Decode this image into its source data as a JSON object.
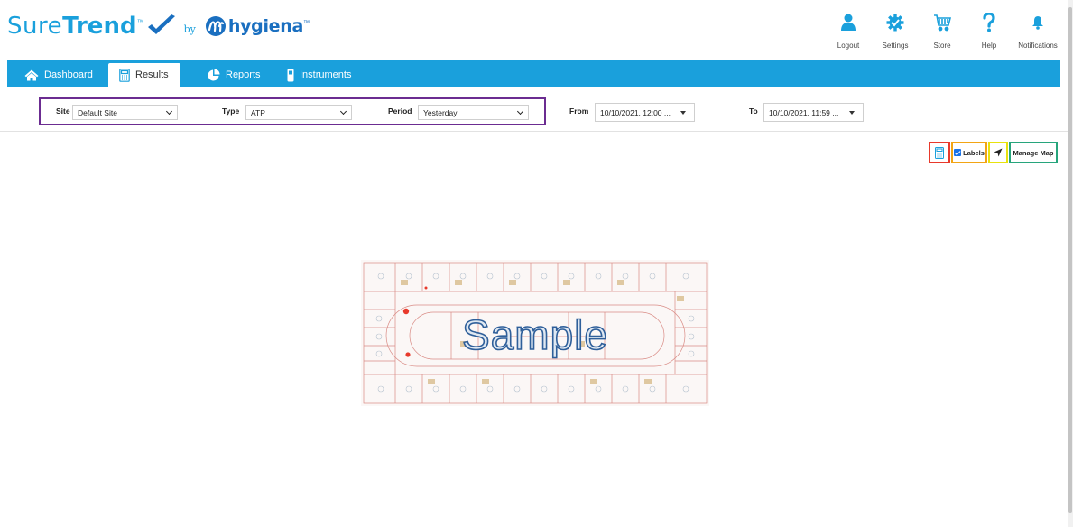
{
  "brand": {
    "name_part1": "Sure",
    "name_part2": "Trend",
    "tm": "™",
    "by": "by",
    "partner": "hygiena",
    "partner_tm": "™",
    "colors": {
      "primary": "#1aa0dc",
      "partner": "#1a6fc0"
    }
  },
  "top_nav": [
    {
      "label": "Logout",
      "icon": "user-icon"
    },
    {
      "label": "Settings",
      "icon": "gear-icon"
    },
    {
      "label": "Store",
      "icon": "cart-icon"
    },
    {
      "label": "Help",
      "icon": "question-icon"
    },
    {
      "label": "Notifications",
      "icon": "bell-icon"
    }
  ],
  "tabs": [
    {
      "label": "Dashboard",
      "icon": "home-icon",
      "active": false
    },
    {
      "label": "Results",
      "icon": "calculator-icon",
      "active": true
    },
    {
      "label": "Reports",
      "icon": "pie-chart-icon",
      "active": false
    },
    {
      "label": "Instruments",
      "icon": "device-icon",
      "active": false
    }
  ],
  "filters": {
    "site": {
      "label": "Site",
      "value": "Default Site"
    },
    "type": {
      "label": "Type",
      "value": "ATP"
    },
    "period": {
      "label": "Period",
      "value": "Yesterday"
    },
    "from": {
      "label": "From",
      "value": "10/10/2021, 12:00 ..."
    },
    "to": {
      "label": "To",
      "value": "10/10/2021, 11:59 ..."
    }
  },
  "map_toolbar": {
    "calc_icon": "calculator-icon",
    "labels_label": "Labels",
    "labels_checked": true,
    "navigate_icon": "location-arrow-icon",
    "manage_label": "Manage Map",
    "highlight_colors": {
      "calc": "#e8392b",
      "labels": "#f2a514",
      "navigate": "#e8e20e",
      "manage": "#27a57c",
      "filters": "#6b2c91"
    }
  },
  "map": {
    "watermark": "Sample",
    "marker_color": "#e8392b"
  }
}
